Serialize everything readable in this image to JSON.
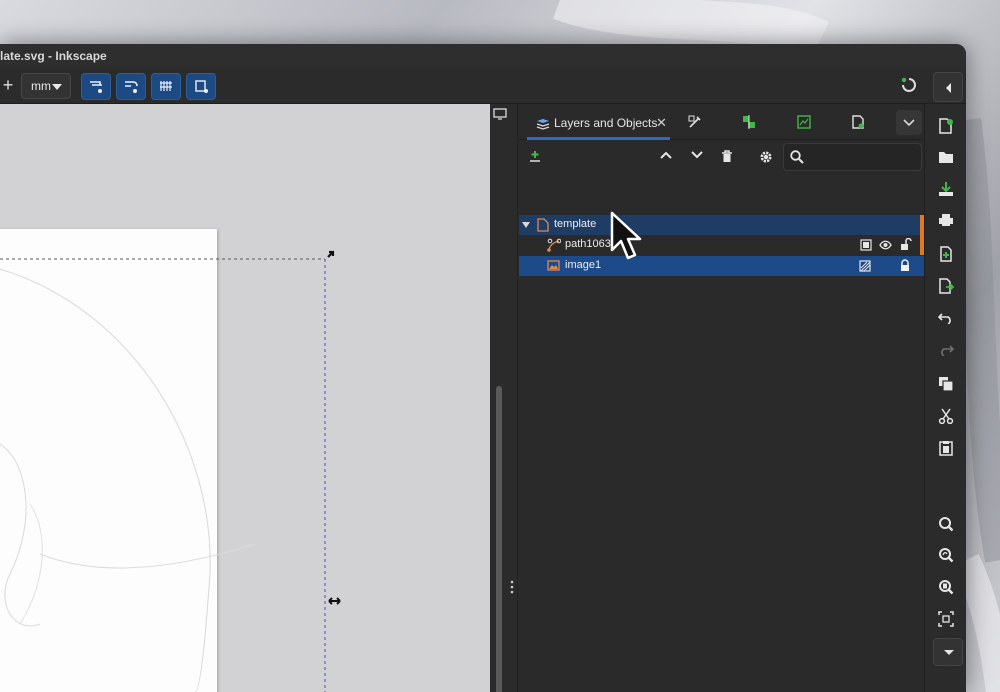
{
  "window": {
    "title": "late.svg - Inkscape"
  },
  "toolbar": {
    "unit_value": "mm",
    "snap_buttons": [
      "snap-bbox-icon",
      "snap-path-icon",
      "snap-grid-icon",
      "snap-page-icon"
    ]
  },
  "colors": {
    "accent_blue": "#1e4a83",
    "selected_row": "#1d4b89",
    "layer_row": "#1f3c64",
    "layer_marker": "#e07a22",
    "canvas_bg": "#d2d2d4"
  },
  "panel": {
    "tabs": [
      {
        "label": "Layers and Objects",
        "icon": "layers-icon",
        "active": true
      },
      {
        "icon": "fill-stroke-icon"
      },
      {
        "icon": "align-icon"
      },
      {
        "icon": "export-image-icon"
      },
      {
        "icon": "document-properties-icon"
      }
    ],
    "tree": [
      {
        "label": "template",
        "type": "layer",
        "icon": "layer-page-icon",
        "expanded": true
      },
      {
        "label": "path1063",
        "type": "path",
        "icon": "path-node-icon",
        "visible": true,
        "locked": false
      },
      {
        "label": "image1",
        "type": "image",
        "icon": "image-icon",
        "selected": true,
        "locked": true
      }
    ]
  },
  "commands": [
    "new-document-icon",
    "open-folder-icon",
    "save-icon",
    "print-icon",
    "import-icon",
    "export-icon",
    "undo-icon",
    "redo-icon",
    "copy-icon",
    "cut-icon",
    "paste-icon",
    "zoom-selection-icon",
    "zoom-drawing-icon",
    "zoom-page-icon",
    "zoom-center-icon"
  ]
}
